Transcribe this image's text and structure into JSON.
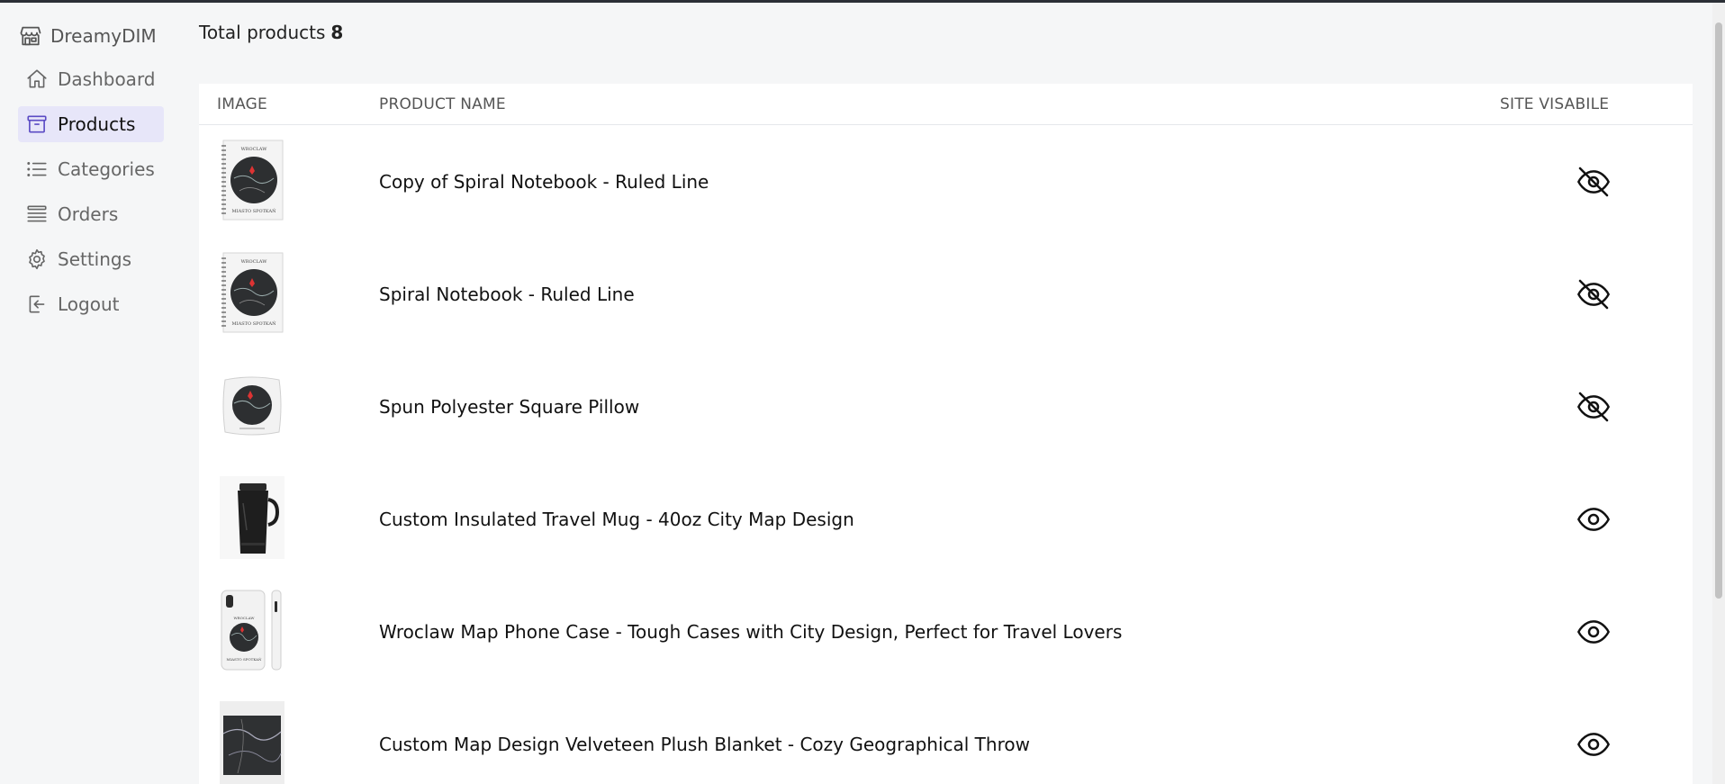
{
  "app": {
    "brand_name": "DreamyDIM"
  },
  "nav": {
    "items": [
      {
        "label": "Dashboard",
        "icon": "home-icon"
      },
      {
        "label": "Products",
        "icon": "archive-box-icon",
        "active": true
      },
      {
        "label": "Categories",
        "icon": "list-icon"
      },
      {
        "label": "Orders",
        "icon": "stack-icon"
      },
      {
        "label": "Settings",
        "icon": "gear-icon"
      },
      {
        "label": "Logout",
        "icon": "logout-icon"
      }
    ]
  },
  "summary": {
    "label": "Total products",
    "count": "8"
  },
  "table": {
    "headers": {
      "image": "IMAGE",
      "name": "PRODUCT NAME",
      "visible": "SITE VISABILE"
    },
    "rows": [
      {
        "name": "Copy of Spiral Notebook - Ruled Line",
        "visible": false,
        "thumb": "notebook",
        "thumb_text_top": "WROCLAW",
        "thumb_text_bottom": "MIASTO SPOTKAŃ"
      },
      {
        "name": "Spiral Notebook - Ruled Line",
        "visible": false,
        "thumb": "notebook",
        "thumb_text_top": "WROCLAW",
        "thumb_text_bottom": "MIASTO SPOTKAŃ"
      },
      {
        "name": "Spun Polyester Square Pillow",
        "visible": false,
        "thumb": "pillow"
      },
      {
        "name": "Custom Insulated Travel Mug - 40oz City Map Design",
        "visible": true,
        "thumb": "mug"
      },
      {
        "name": "Wroclaw Map Phone Case - Tough Cases with City Design, Perfect for Travel Lovers",
        "visible": true,
        "thumb": "phonecase",
        "thumb_text_top": "WROCLAW",
        "thumb_text_bottom": "MIASTO SPOTKAŃ"
      },
      {
        "name": "Custom Map Design Velveteen Plush Blanket - Cozy Geographical Throw",
        "visible": true,
        "thumb": "blanket"
      }
    ]
  },
  "colors": {
    "active_nav_bg": "#e7e6f9",
    "accent": "#5b4bc4",
    "page_bg": "#f5f6f7"
  }
}
